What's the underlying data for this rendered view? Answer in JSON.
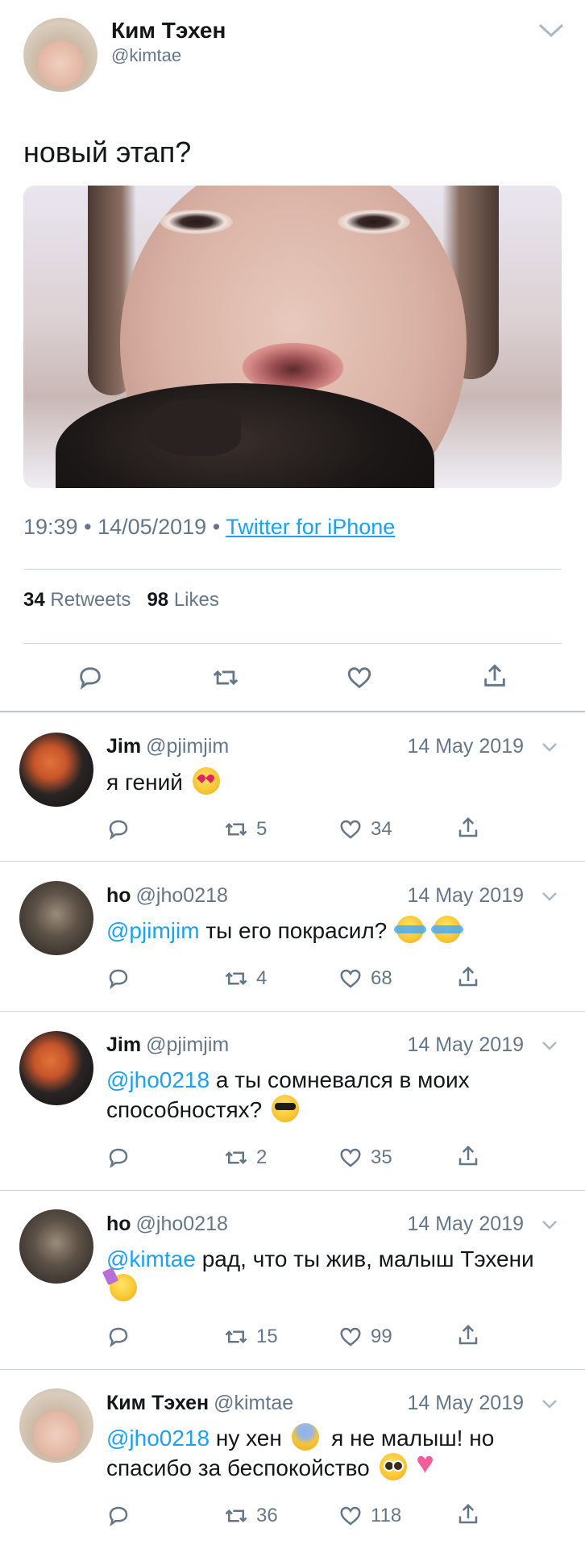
{
  "tweet": {
    "author_name": "Ким Тэхен",
    "author_handle": "@kimtae",
    "text": "новый этап?",
    "time": "19:39",
    "date": "14/05/2019",
    "separator": "•",
    "source": "Twitter for iPhone",
    "retweets_count": "34",
    "retweets_label": "Retweets",
    "likes_count": "98",
    "likes_label": "Likes"
  },
  "replies": [
    {
      "name": "Jim",
      "handle": "@pjimjim",
      "date": "14 May 2019",
      "mention": "",
      "text": "я гений",
      "emojis": [
        "heart-eyes"
      ],
      "retweets": "5",
      "likes": "34"
    },
    {
      "name": "ho",
      "handle": "@jho0218",
      "date": "14 May 2019",
      "mention": "@pjimjim",
      "text": "ты его покрасил?",
      "emojis": [
        "cry",
        "cry"
      ],
      "retweets": "4",
      "likes": "68"
    },
    {
      "name": "Jim",
      "handle": "@pjimjim",
      "date": "14 May 2019",
      "mention": "@jho0218",
      "text": "а ты сомневался в моих способностях?",
      "emojis": [
        "cool"
      ],
      "retweets": "2",
      "likes": "35"
    },
    {
      "name": "ho",
      "handle": "@jho0218",
      "date": "14 May 2019",
      "mention": "@kimtae",
      "text": "рад, что ты жив, малыш Тэхени",
      "emojis": [
        "party"
      ],
      "retweets": "15",
      "likes": "99"
    },
    {
      "name": "Ким Тэхен",
      "handle": "@kimtae",
      "date": "14 May 2019",
      "mention": "@jho0218",
      "text_part1": "ну хен",
      "text_part2": "я не малыш! но спасибо за беспокойство",
      "emojis": [
        "scared",
        "plead",
        "sparkle-heart"
      ],
      "retweets": "36",
      "likes": "118"
    }
  ],
  "colors": {
    "accent": "#1da1f2",
    "secondary_text": "#657786",
    "primary_text": "#14171a",
    "divider": "#ccd6dd"
  },
  "icons": [
    "chevron-down-icon",
    "reply-icon",
    "retweet-icon",
    "like-icon",
    "share-icon"
  ]
}
